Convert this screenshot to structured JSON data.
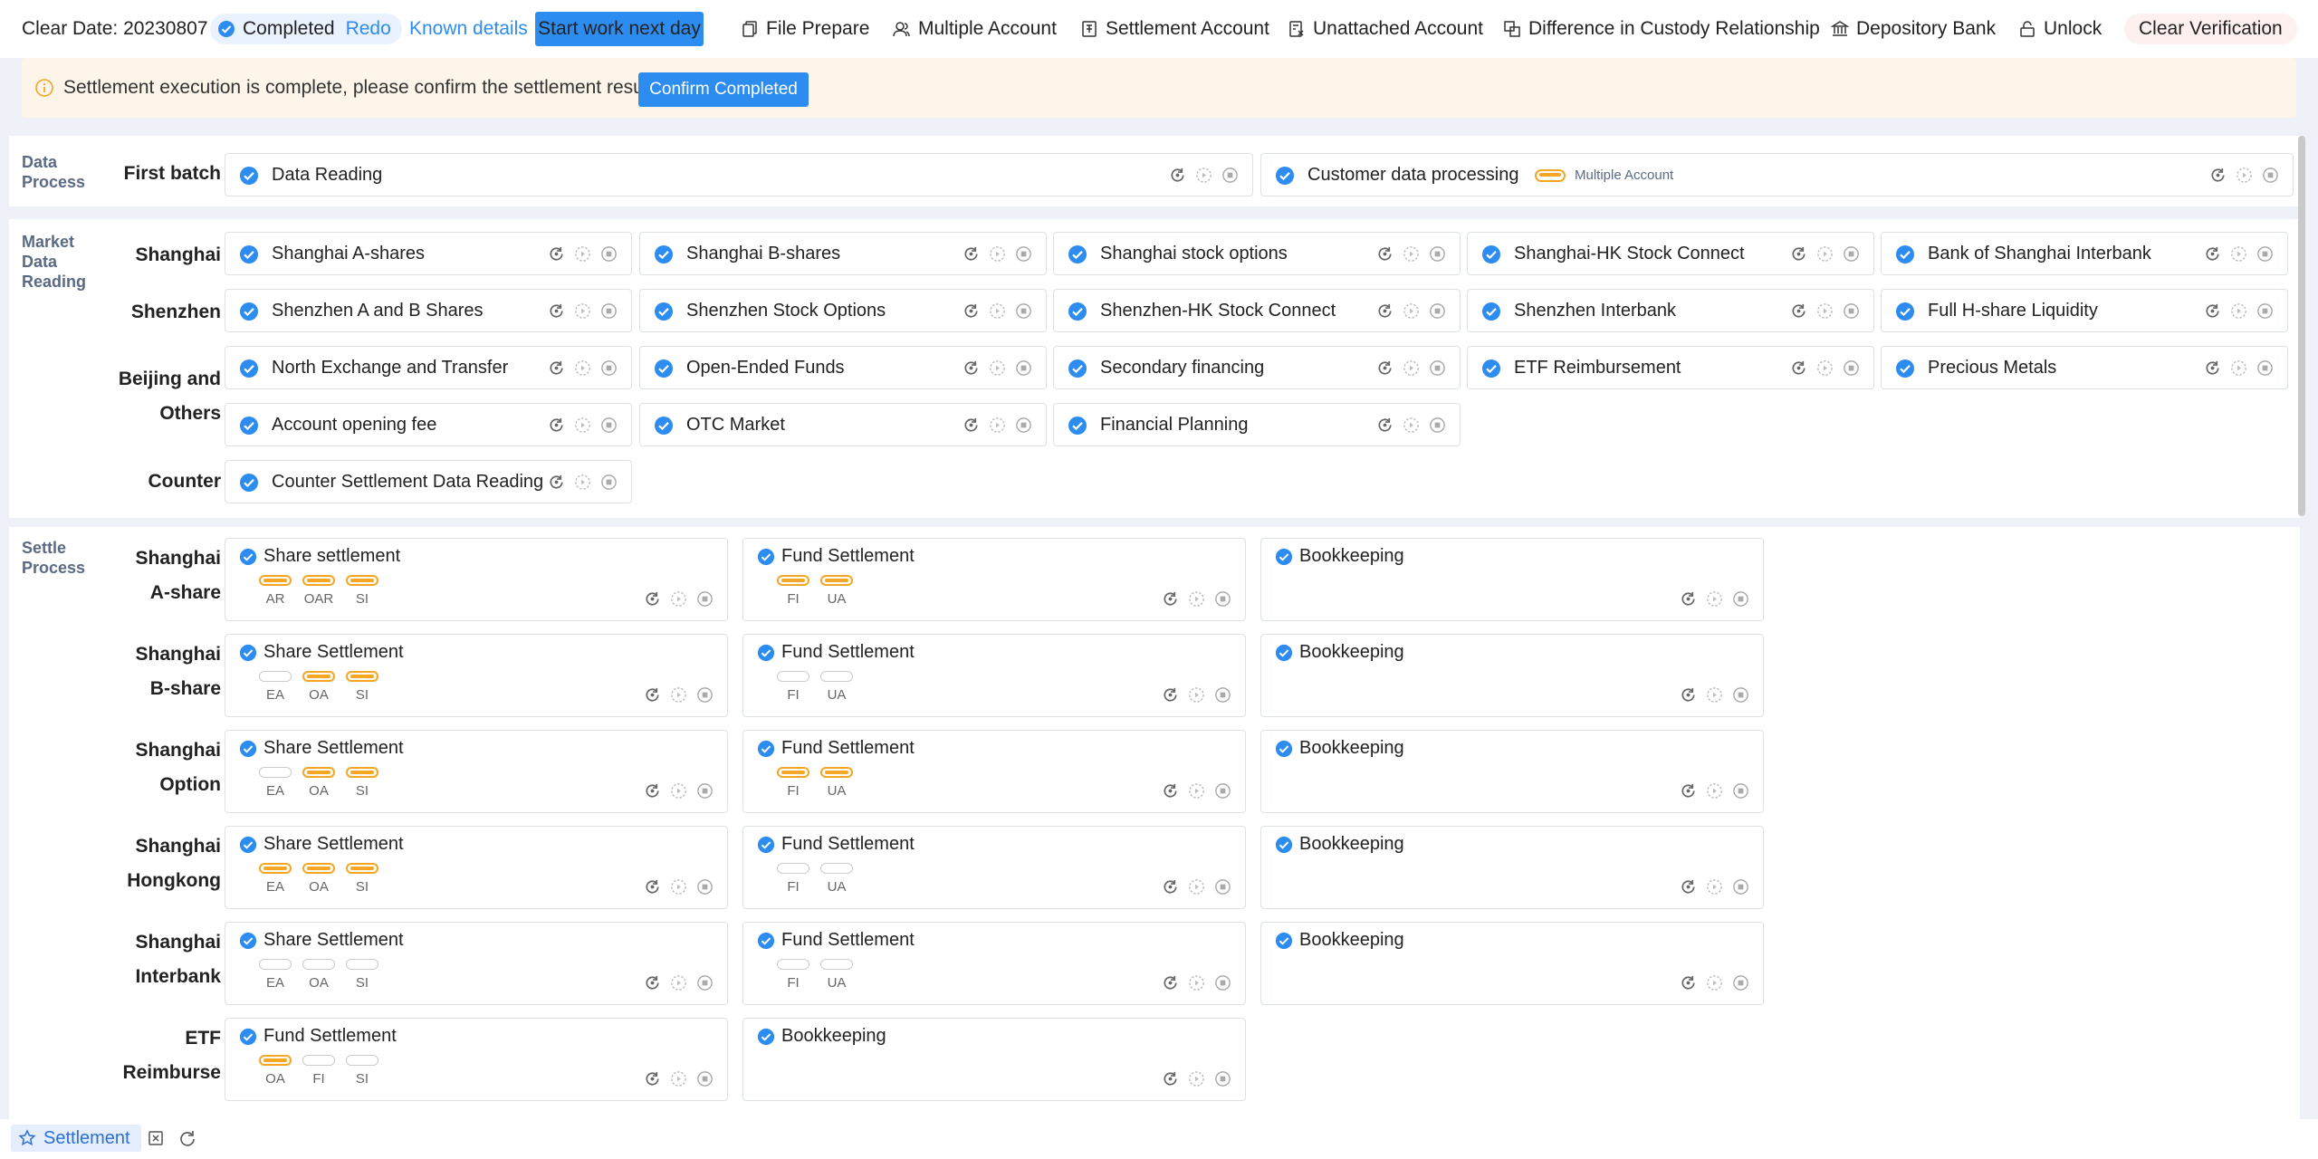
{
  "topbar": {
    "clear_date_label": "Clear Date:",
    "clear_date_value": "20230807",
    "status": "Completed",
    "redo": "Redo",
    "known_details": "Known details",
    "start_next_day": "Start work next day",
    "actions": [
      "File Prepare",
      "Multiple Account",
      "Settlement Account",
      "Unattached Account",
      "Difference in Custody Relationship",
      "Depository Bank",
      "Unlock"
    ],
    "clear_verification": "Clear Verification"
  },
  "banner": {
    "message": "Settlement execution is complete, please confirm the settlement results",
    "confirm_button": "Confirm Completed"
  },
  "data_process": {
    "title": [
      "Data",
      "Process"
    ],
    "row_label": "First batch",
    "cards": [
      "Data Reading",
      "Customer data processing"
    ],
    "tag_label": "Multiple Account"
  },
  "market": {
    "title": [
      "Market",
      "Data",
      "Reading"
    ],
    "rows": [
      {
        "label": "Shanghai",
        "cards": [
          "Shanghai A-shares",
          "Shanghai B-shares",
          "Shanghai stock options",
          "Shanghai-HK Stock Connect",
          "Bank of Shanghai Interbank"
        ]
      },
      {
        "label": "Shenzhen",
        "cards": [
          "Shenzhen A and B Shares",
          "Shenzhen Stock Options",
          "Shenzhen-HK Stock Connect",
          "Shenzhen Interbank",
          "Full H-share Liquidity"
        ]
      },
      {
        "label": "Beijing and Others",
        "cards": [
          "North Exchange and Transfer",
          "Open-Ended Funds",
          "Secondary financing",
          "ETF Reimbursement",
          "Precious Metals",
          "Account opening fee",
          "OTC Market",
          "Financial Planning"
        ]
      },
      {
        "label": "Counter",
        "cards": [
          "Counter Settlement Data Reading"
        ]
      }
    ]
  },
  "settle": {
    "title": [
      "Settle",
      "Process"
    ],
    "rows": [
      {
        "label": [
          "Shanghai",
          "A-share"
        ],
        "cards": [
          {
            "name": "Share settlement",
            "toggles": [
              {
                "t": "AR",
                "on": true
              },
              {
                "t": "OAR",
                "on": true
              },
              {
                "t": "SI",
                "on": true
              }
            ]
          },
          {
            "name": "Fund Settlement",
            "toggles": [
              {
                "t": "FI",
                "on": true
              },
              {
                "t": "UA",
                "on": true
              }
            ]
          },
          {
            "name": "Bookkeeping",
            "toggles": []
          }
        ]
      },
      {
        "label": [
          "Shanghai",
          "B-share"
        ],
        "cards": [
          {
            "name": "Share Settlement",
            "toggles": [
              {
                "t": "EA",
                "on": false
              },
              {
                "t": "OA",
                "on": true
              },
              {
                "t": "SI",
                "on": true
              }
            ]
          },
          {
            "name": "Fund Settlement",
            "toggles": [
              {
                "t": "FI",
                "on": false
              },
              {
                "t": "UA",
                "on": false
              }
            ]
          },
          {
            "name": "Bookkeeping",
            "toggles": []
          }
        ]
      },
      {
        "label": [
          "Shanghai",
          "Option"
        ],
        "cards": [
          {
            "name": "Share Settlement",
            "toggles": [
              {
                "t": "EA",
                "on": false
              },
              {
                "t": "OA",
                "on": true
              },
              {
                "t": "SI",
                "on": true
              }
            ]
          },
          {
            "name": "Fund Settlement",
            "toggles": [
              {
                "t": "FI",
                "on": true
              },
              {
                "t": "UA",
                "on": true
              }
            ]
          },
          {
            "name": "Bookkeeping",
            "toggles": []
          }
        ]
      },
      {
        "label": [
          "Shanghai",
          "Hongkong"
        ],
        "cards": [
          {
            "name": "Share Settlement",
            "toggles": [
              {
                "t": "EA",
                "on": true
              },
              {
                "t": "OA",
                "on": true
              },
              {
                "t": "SI",
                "on": true
              }
            ]
          },
          {
            "name": "Fund Settlement",
            "toggles": [
              {
                "t": "FI",
                "on": false
              },
              {
                "t": "UA",
                "on": false
              }
            ]
          },
          {
            "name": "Bookkeeping",
            "toggles": []
          }
        ]
      },
      {
        "label": [
          "Shanghai",
          "Interbank"
        ],
        "cards": [
          {
            "name": "Share Settlement",
            "toggles": [
              {
                "t": "EA",
                "on": false
              },
              {
                "t": "OA",
                "on": false
              },
              {
                "t": "SI",
                "on": false
              }
            ]
          },
          {
            "name": "Fund Settlement",
            "toggles": [
              {
                "t": "FI",
                "on": false
              },
              {
                "t": "UA",
                "on": false
              }
            ]
          },
          {
            "name": "Bookkeeping",
            "toggles": []
          }
        ]
      },
      {
        "label": [
          "ETF",
          "Reimburse"
        ],
        "cards": [
          {
            "name": "Fund Settlement",
            "toggles": [
              {
                "t": "OA",
                "on": true
              },
              {
                "t": "FI",
                "on": false
              },
              {
                "t": "SI",
                "on": false
              }
            ]
          },
          {
            "name": "Bookkeeping",
            "toggles": []
          }
        ]
      }
    ]
  },
  "bottombar": {
    "tab": "Settlement"
  },
  "colors": {
    "primary": "#2d8cf0",
    "toggle_on": "#f5a623",
    "danger": "#f0666e",
    "banner_bg": "#fdf5ea"
  }
}
